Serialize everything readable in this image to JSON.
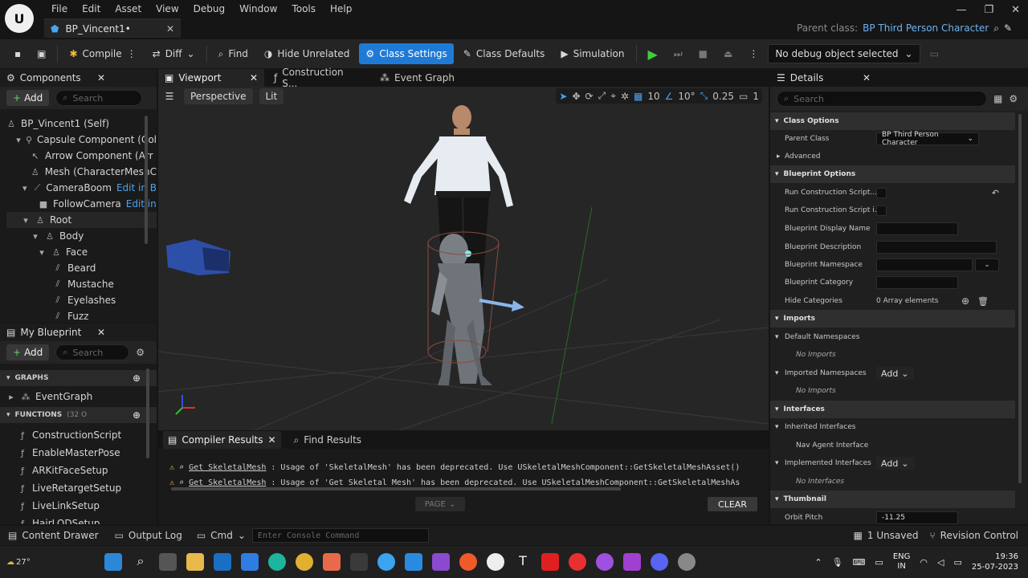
{
  "menu": [
    "File",
    "Edit",
    "Asset",
    "View",
    "Debug",
    "Window",
    "Tools",
    "Help"
  ],
  "doc_tab": "BP_Vincent1•",
  "parent_class": {
    "label": "Parent class:",
    "value": "BP Third Person Character"
  },
  "toolbar": {
    "compile": "Compile",
    "diff": "Diff",
    "find": "Find",
    "hide_unrelated": "Hide Unrelated",
    "class_settings": "Class Settings",
    "class_defaults": "Class Defaults",
    "simulation": "Simulation",
    "debug_object": "No debug object selected"
  },
  "components": {
    "title": "Components",
    "add": "Add",
    "search_placeholder": "Search",
    "items": [
      {
        "label": "BP_Vincent1 (Self)",
        "link": ""
      },
      {
        "label": "Capsule Component (Col",
        "link": ""
      },
      {
        "label": "Arrow Component (Arr",
        "link": ""
      },
      {
        "label": "Mesh (CharacterMeshC",
        "link": ""
      },
      {
        "label": "CameraBoom",
        "link": "Edit in B"
      },
      {
        "label": "FollowCamera",
        "link": "Edit in"
      },
      {
        "label": "Root",
        "link": ""
      },
      {
        "label": "Body",
        "link": ""
      },
      {
        "label": "Face",
        "link": ""
      },
      {
        "label": "Beard",
        "link": ""
      },
      {
        "label": "Mustache",
        "link": ""
      },
      {
        "label": "Eyelashes",
        "link": ""
      },
      {
        "label": "Fuzz",
        "link": ""
      }
    ]
  },
  "my_blueprint": {
    "title": "My Blueprint",
    "add": "Add",
    "search_placeholder": "Search",
    "graphs_label": "GRAPHS",
    "event_graph": "EventGraph",
    "functions_label": "FUNCTIONS",
    "functions_count": "(32 O",
    "functions": [
      "ConstructionScript",
      "EnableMasterPose",
      "ARKitFaceSetup",
      "LiveRetargetSetup",
      "LiveLinkSetup",
      "HairLODSetup"
    ]
  },
  "editor_tabs": [
    "Viewport",
    "Construction S...",
    "Event Graph"
  ],
  "viewport": {
    "perspective": "Perspective",
    "lit": "Lit",
    "grid_snap": "10",
    "rot_snap": "10°",
    "scale_snap": "0.25",
    "cam_speed": "1"
  },
  "compiler": {
    "tab1": "Compiler Results",
    "tab2": "Find Results",
    "lines": [
      {
        "link": "Get SkeletalMesh",
        "text": ": Usage of 'SkeletalMesh' has been deprecated. Use USkeletalMeshComponent::GetSkeletalMeshAsset()"
      },
      {
        "link": "Get SkeletalMesh",
        "text": ": Usage of 'Get Skeletal Mesh' has been deprecated. Use USkeletalMeshComponent::GetSkeletalMeshAs"
      }
    ],
    "page": "PAGE",
    "clear": "CLEAR"
  },
  "details": {
    "title": "Details",
    "search_placeholder": "Search",
    "class_options": "Class Options",
    "parent_class_label": "Parent Class",
    "parent_class_value": "BP Third Person Character",
    "advanced": "Advanced",
    "blueprint_options": "Blueprint Options",
    "run_cs1": "Run Construction Script...",
    "run_cs2": "Run Construction Script i...",
    "bp_display_name": "Blueprint Display Name",
    "bp_description": "Blueprint Description",
    "bp_namespace": "Blueprint Namespace",
    "bp_category": "Blueprint Category",
    "hide_categories": "Hide Categories",
    "array_elements": "0 Array elements",
    "imports": "Imports",
    "default_ns": "Default Namespaces",
    "no_imports": "No Imports",
    "imported_ns": "Imported Namespaces",
    "add": "Add",
    "interfaces": "Interfaces",
    "inherited_interfaces": "Inherited Interfaces",
    "nav_agent": "Nav Agent Interface",
    "implemented_interfaces": "Implemented Interfaces",
    "no_interfaces": "No Interfaces",
    "thumbnail": "Thumbnail",
    "orbit_pitch": "Orbit Pitch",
    "orbit_pitch_value": "-11.25"
  },
  "statusbar": {
    "content_drawer": "Content Drawer",
    "output_log": "Output Log",
    "cmd": "Cmd",
    "console_placeholder": "Enter Console Command",
    "unsaved": "1 Unsaved",
    "revision": "Revision Control"
  },
  "taskbar": {
    "temp": "27°",
    "lang1": "ENG",
    "lang2": "IN",
    "time": "19:36",
    "date": "25-07-2023"
  }
}
